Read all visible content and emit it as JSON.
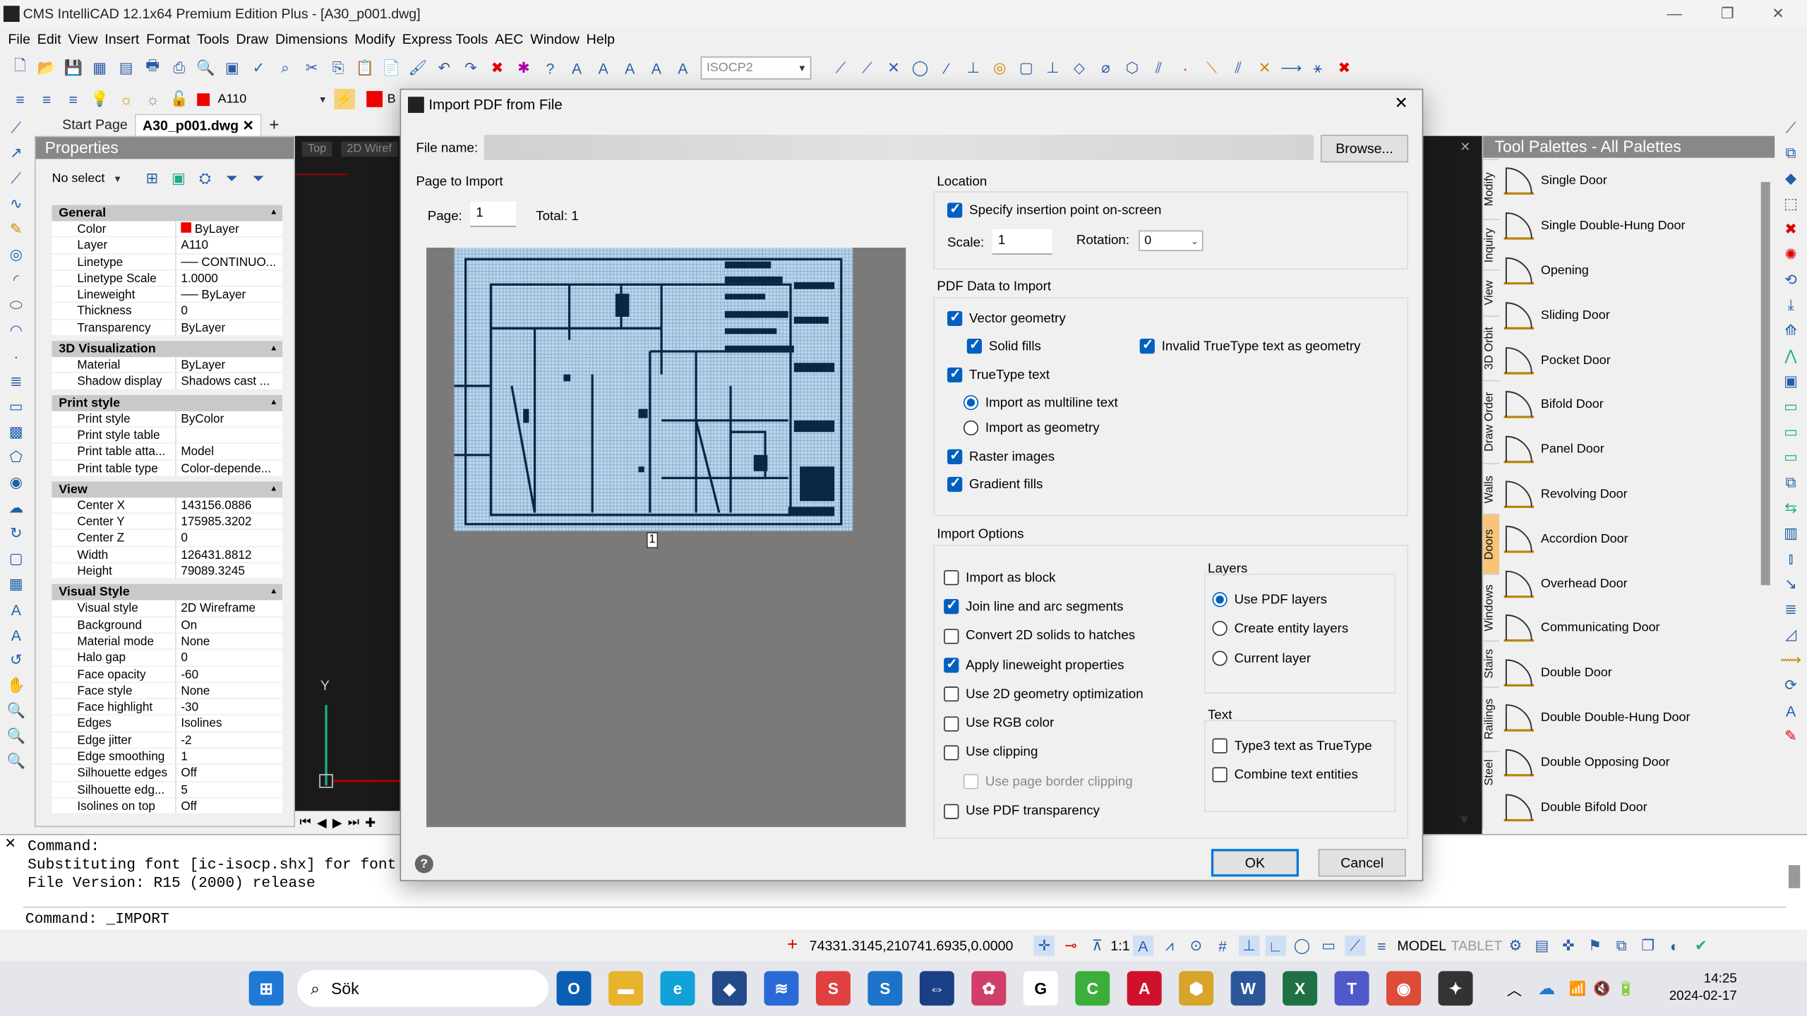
{
  "app": {
    "title": "CMS IntelliCAD 12.1x64 Premium Edition Plus  - [A30_p001.dwg]"
  },
  "menu": [
    "File",
    "Edit",
    "View",
    "Insert",
    "Format",
    "Tools",
    "Draw",
    "Dimensions",
    "Modify",
    "Express Tools",
    "AEC",
    "Window",
    "Help"
  ],
  "toolbar": {
    "textstyle": "ISOCP2",
    "layer": "A110",
    "color_short": "B"
  },
  "tabs": [
    {
      "label": "Start Page"
    },
    {
      "label": "A30_p001.dwg"
    }
  ],
  "properties": {
    "title": "Properties",
    "selection": "No select",
    "sections": [
      {
        "name": "General",
        "rows": [
          [
            "Color",
            "ByLayer"
          ],
          [
            "Layer",
            "A110"
          ],
          [
            "Linetype",
            "── CONTINUO..."
          ],
          [
            "Linetype Scale",
            "1.0000"
          ],
          [
            "Lineweight",
            "── ByLayer"
          ],
          [
            "Thickness",
            "0"
          ],
          [
            "Transparency",
            "ByLayer"
          ]
        ]
      },
      {
        "name": "3D Visualization",
        "rows": [
          [
            "Material",
            "ByLayer"
          ],
          [
            "Shadow display",
            "Shadows cast ..."
          ]
        ]
      },
      {
        "name": "Print style",
        "rows": [
          [
            "Print style",
            "ByColor"
          ],
          [
            "Print style table",
            ""
          ],
          [
            "Print table atta...",
            "Model"
          ],
          [
            "Print table type",
            "Color-depende..."
          ]
        ]
      },
      {
        "name": "View",
        "rows": [
          [
            "Center X",
            "143156.0886"
          ],
          [
            "Center Y",
            "175985.3202"
          ],
          [
            "Center Z",
            "0"
          ],
          [
            "Width",
            "126431.8812"
          ],
          [
            "Height",
            "79089.3245"
          ]
        ]
      },
      {
        "name": "Visual Style",
        "rows": [
          [
            "Visual style",
            "2D Wireframe"
          ],
          [
            "Background",
            "On"
          ],
          [
            "Material mode",
            "None"
          ],
          [
            "Halo gap",
            "0"
          ],
          [
            "Face opacity",
            "-60"
          ],
          [
            "Face style",
            "None"
          ],
          [
            "Face highlight",
            "-30"
          ],
          [
            "Edges",
            "Isolines"
          ],
          [
            "Edge jitter",
            "-2"
          ],
          [
            "Edge smoothing",
            "1"
          ],
          [
            "Silhouette edges",
            "Off"
          ],
          [
            "Silhouette edg...",
            "5"
          ],
          [
            "Isolines on top",
            "Off"
          ]
        ]
      }
    ]
  },
  "viewport": {
    "views": [
      "Top",
      "2D Wiref"
    ],
    "axis_y": "Y"
  },
  "palette": {
    "title": "Tool Palettes - All Palettes",
    "tabs": [
      "Modify",
      "Inquiry",
      "View",
      "3D Orbit",
      "Draw Order",
      "Walls",
      "Doors",
      "Windows",
      "Stairs",
      "Railings",
      "Steel"
    ],
    "tools": [
      "Single Door",
      "Single Double-Hung Door",
      "Opening",
      "Sliding Door",
      "Pocket Door",
      "Bifold Door",
      "Panel Door",
      "Revolving Door",
      "Accordion Door",
      "Overhead Door",
      "Communicating Door",
      "Double Door",
      "Double Double-Hung Door",
      "Double Opposing Door",
      "Double Bifold Door"
    ]
  },
  "command": {
    "lines": [
      "Command:",
      "Substituting font [ic-isocp.shx] for font",
      "File Version: R15 (2000) release"
    ],
    "prompt": "Command: _IMPORT"
  },
  "status": {
    "coords": "74331.3145,210741.6935,0.0000",
    "scale": "1:1",
    "model": "MODEL",
    "tablet": "TABLET"
  },
  "taskbar": {
    "search": "Sök",
    "time": "14:25",
    "date": "2024-02-17"
  },
  "dialog": {
    "title": "Import PDF from File",
    "file_name_label": "File name:",
    "browse": "Browse...",
    "page_group": "Page to Import",
    "page_label": "Page:",
    "page_value": "1",
    "total": "Total: 1",
    "thumb_page": "1",
    "location": {
      "title": "Location",
      "specify": "Specify insertion point on-screen",
      "specify_checked": true,
      "scale_label": "Scale:",
      "scale": "1",
      "rotation_label": "Rotation:",
      "rotation": "0"
    },
    "pdf_data": {
      "title": "PDF Data to Import",
      "vector": "Vector geometry",
      "solid": "Solid fills",
      "invalid_tt": "Invalid TrueType text as geometry",
      "truetype": "TrueType text",
      "multiline": "Import as multiline text",
      "as_geom": "Import as geometry",
      "raster": "Raster images",
      "gradient": "Gradient fills"
    },
    "options": {
      "title": "Import Options",
      "items": [
        {
          "label": "Import as block",
          "checked": false
        },
        {
          "label": "Join line and arc segments",
          "checked": true
        },
        {
          "label": "Convert 2D solids to hatches",
          "checked": false
        },
        {
          "label": "Apply lineweight properties",
          "checked": true
        },
        {
          "label": "Use 2D geometry optimization",
          "checked": false
        },
        {
          "label": "Use RGB color",
          "checked": false
        },
        {
          "label": "Use clipping",
          "checked": false
        },
        {
          "label": "Use page border clipping",
          "checked": false
        },
        {
          "label": "Use PDF transparency",
          "checked": false
        }
      ],
      "layers_title": "Layers",
      "layers": [
        "Use PDF layers",
        "Create entity layers",
        "Current layer"
      ],
      "text_title": "Text",
      "text": [
        "Type3 text as TrueType",
        "Combine text entities"
      ]
    },
    "ok": "OK",
    "cancel": "Cancel",
    "help": "?"
  }
}
